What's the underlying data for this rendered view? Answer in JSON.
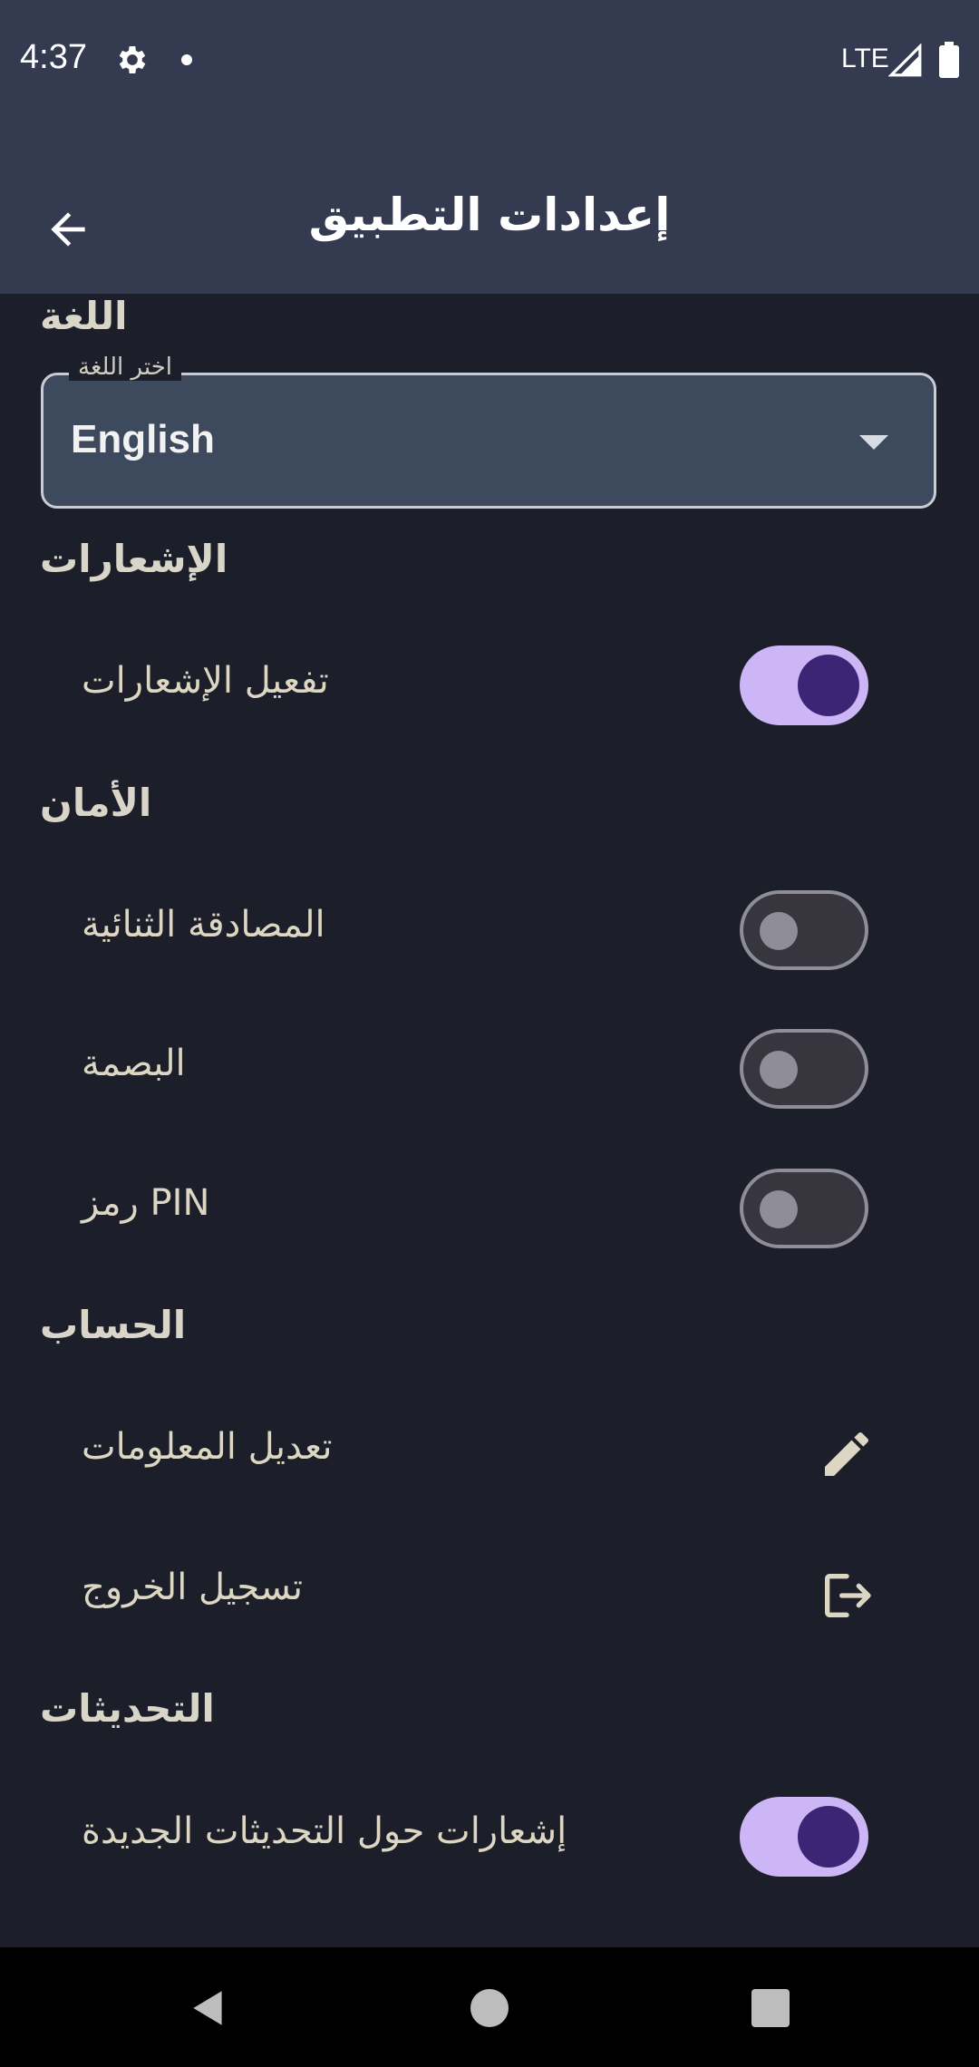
{
  "status_bar": {
    "time": "4:37",
    "network": "LTE",
    "icons": [
      "settings-gear-icon",
      "notification-dot-icon",
      "signal-icon",
      "battery-icon"
    ]
  },
  "toolbar": {
    "title": "إعدادات التطبيق",
    "back_icon": "arrow-back-icon"
  },
  "language": {
    "section_title": "اللغة",
    "select_label": "اختر اللغة",
    "selected_value": "English"
  },
  "notifications": {
    "section_title": "الإشعارات",
    "enable_label": "تفعيل الإشعارات",
    "enable_on": true
  },
  "security": {
    "section_title": "الأمان",
    "two_factor_label": "المصادقة الثنائية",
    "two_factor_on": false,
    "fingerprint_label": "البصمة",
    "fingerprint_on": false,
    "pin_label": "رمز PIN",
    "pin_on": false
  },
  "account": {
    "section_title": "الحساب",
    "edit_info_label": "تعديل المعلومات",
    "edit_icon": "pencil-edit-icon",
    "logout_label": "تسجيل الخروج",
    "logout_icon": "logout-icon"
  },
  "updates": {
    "section_title": "التحديثات",
    "update_notifications_label": "إشعارات حول التحديثات الجديدة",
    "update_notifications_on": true
  },
  "colors": {
    "bar_background": "#343a50",
    "page_background": "#1c1f2a",
    "toggle_on_track": "#cdb6f5",
    "toggle_on_knob": "#3d2576",
    "toggle_off_outline": "#8f8e98"
  },
  "nav_bar": {
    "icons": [
      "nav-back-icon",
      "nav-home-icon",
      "nav-recents-icon"
    ]
  }
}
